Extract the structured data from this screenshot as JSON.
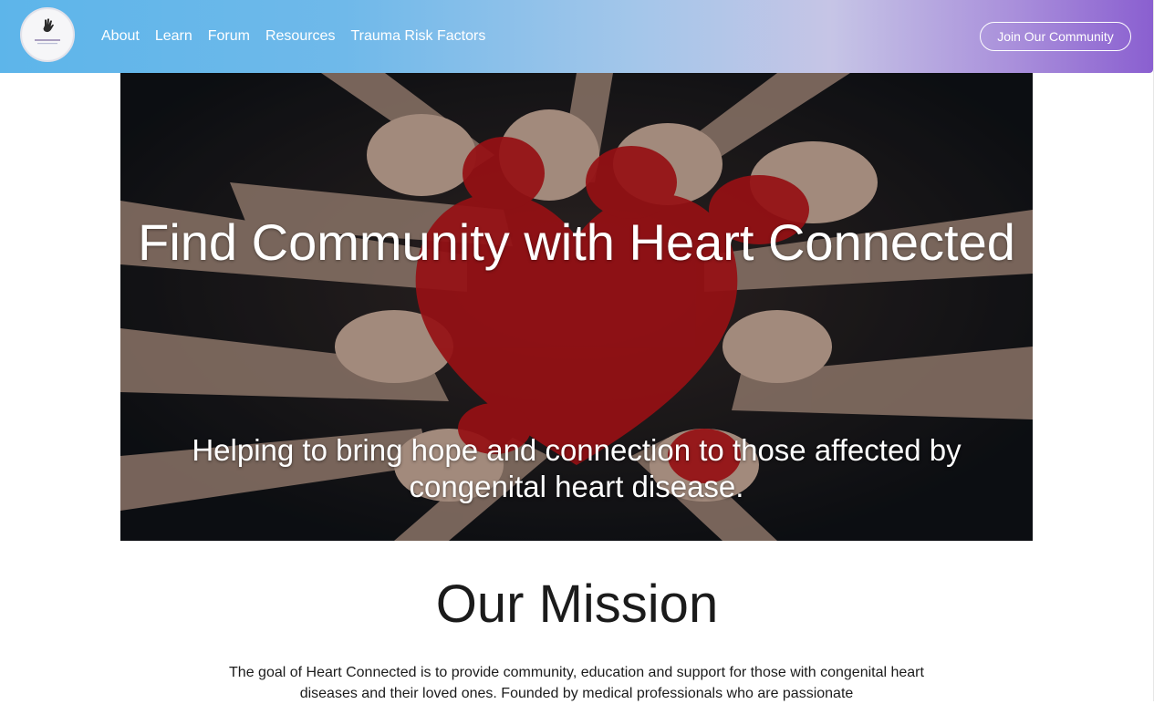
{
  "nav": {
    "logo_icon": "hand-icon",
    "logo_text": "heart connected",
    "links": [
      "About",
      "Learn",
      "Forum",
      "Resources",
      "Trauma Risk Factors"
    ],
    "join_label": "Join Our Community"
  },
  "hero": {
    "title": "Find Community with Heart Connected",
    "subtitle": "Helping to bring hope and connection to those affected by congenital heart disease."
  },
  "mission": {
    "title": "Our Mission",
    "text": "The goal of Heart Connected is to provide community, education and support for those with congenital heart diseases and their loved ones. Founded by medical professionals who are passionate"
  },
  "colors": {
    "nav_gradient_start": "#5db5ea",
    "nav_gradient_end": "#8a5fd0",
    "heart_paint": "#c8161b"
  }
}
